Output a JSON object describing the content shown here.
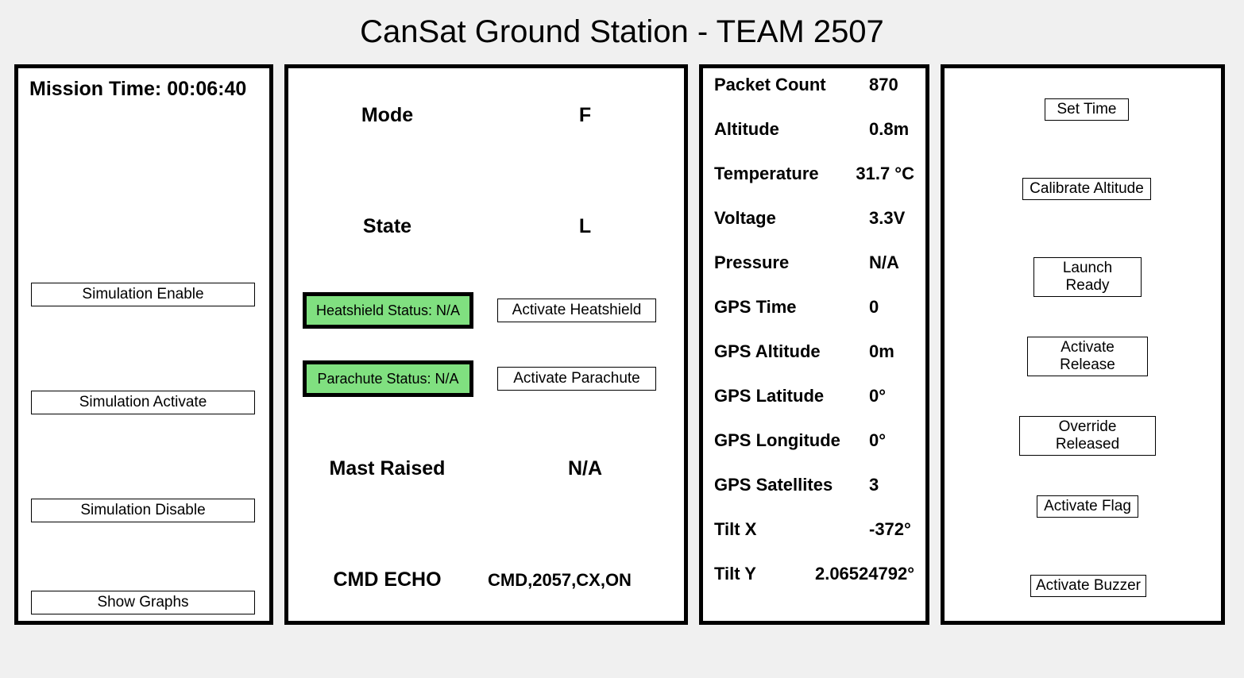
{
  "title": "CanSat Ground Station - TEAM 2507",
  "mission_time": {
    "label": "Mission Time:",
    "value": "00:06:40"
  },
  "sim_buttons": {
    "enable": "Simulation Enable",
    "activate": "Simulation Activate",
    "disable": "Simulation Disable",
    "show_graphs": "Show Graphs"
  },
  "status": {
    "mode_label": "Mode",
    "mode_value": "F",
    "state_label": "State",
    "state_value": "L",
    "heatshield_badge": "Heatshield Status: N/A",
    "heatshield_button": "Activate Heatshield",
    "parachute_badge": "Parachute Status: N/A",
    "parachute_button": "Activate Parachute",
    "mast_label": "Mast Raised",
    "mast_value": "N/A",
    "cmd_echo_label": "CMD ECHO",
    "cmd_echo_value": "CMD,2057,CX,ON"
  },
  "telemetry": {
    "packet_count": {
      "label": "Packet Count",
      "value": "870"
    },
    "altitude": {
      "label": "Altitude",
      "value": "0.8m"
    },
    "temperature": {
      "label": "Temperature",
      "value": "31.7 °C"
    },
    "voltage": {
      "label": "Voltage",
      "value": "3.3V"
    },
    "pressure": {
      "label": "Pressure",
      "value": "N/A"
    },
    "gps_time": {
      "label": "GPS Time",
      "value": "0"
    },
    "gps_altitude": {
      "label": "GPS Altitude",
      "value": "0m"
    },
    "gps_latitude": {
      "label": "GPS Latitude",
      "value": "0°"
    },
    "gps_longitude": {
      "label": "GPS Longitude",
      "value": "0°"
    },
    "gps_satellites": {
      "label": "GPS Satellites",
      "value": "3"
    },
    "tilt_x": {
      "label": "Tilt X",
      "value": "-372°"
    },
    "tilt_y": {
      "label": "Tilt Y",
      "value": "2.06524792°"
    }
  },
  "controls": {
    "set_time": "Set Time",
    "calibrate_alt": "Calibrate Altitude",
    "launch_ready": "Launch Ready",
    "activate_release": "Activate Release",
    "override_released": "Override Released",
    "activate_flag": "Activate Flag",
    "activate_buzzer": "Activate Buzzer"
  },
  "colors": {
    "status_ok_bg": "#80e080"
  }
}
